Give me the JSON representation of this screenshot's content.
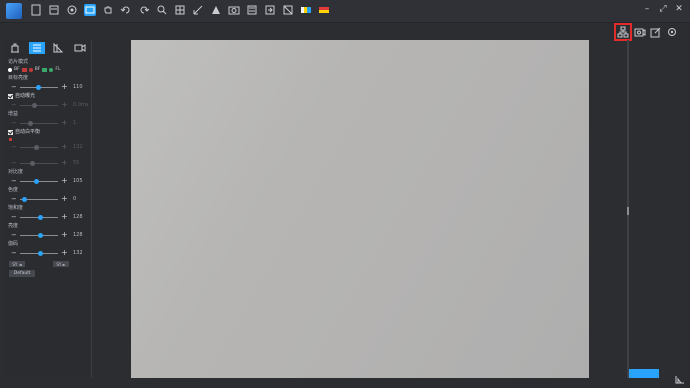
{
  "titlebar": {
    "icons": [
      "app-logo",
      "new-icon",
      "open-icon",
      "record-icon",
      "capture-icon",
      "hand-icon",
      "undo-icon",
      "redo-icon",
      "zoom-icon",
      "grid-icon",
      "measure-icon",
      "triangle-icon",
      "camera-icon",
      "list-icon",
      "export-icon",
      "image-icon",
      "color-bar-icon",
      "palette-icon"
    ],
    "window_controls": [
      "–",
      "⤢",
      "✕"
    ]
  },
  "right_toolbar": {
    "icons": [
      "network-icon",
      "snapshot-icon",
      "edit-icon",
      "settings-icon"
    ]
  },
  "sidebar": {
    "tabs": [
      "camera-tab",
      "adjust-tab",
      "measure-tab",
      "video-tab"
    ],
    "capture_mode_label": "访片模式",
    "modes": [
      {
        "label": "BF",
        "color": "#ffffff"
      },
      {
        "label": "BF",
        "color": "#c23a3a"
      },
      {
        "label": "FL",
        "color": "#3aa96b"
      }
    ],
    "exposure_target_label": "目标亮度",
    "exposure_target_value": "110",
    "auto_exposure_label": "自动曝光",
    "exposure_time_value": "0.0ms",
    "gain_label": "增益",
    "gain_value": "1",
    "auto_wb_label": "自动白平衡",
    "red_value": "132",
    "blue_value": "55",
    "contrast_label": "对比度",
    "contrast_value": "105",
    "hue_label": "色度",
    "hue_value": "0",
    "saturation_label": "饱和度",
    "saturation_value": "128",
    "brightness_label": "亮度",
    "brightness_value": "128",
    "gamma_label": "伽码",
    "gamma_value": "132",
    "btn1": "SY ◄",
    "btn2": "SY ►",
    "default_btn": "Default"
  },
  "colors": {
    "accent": "#2aa3ff",
    "highlight_border": "#e22b2b",
    "background": "#2b2d31"
  }
}
